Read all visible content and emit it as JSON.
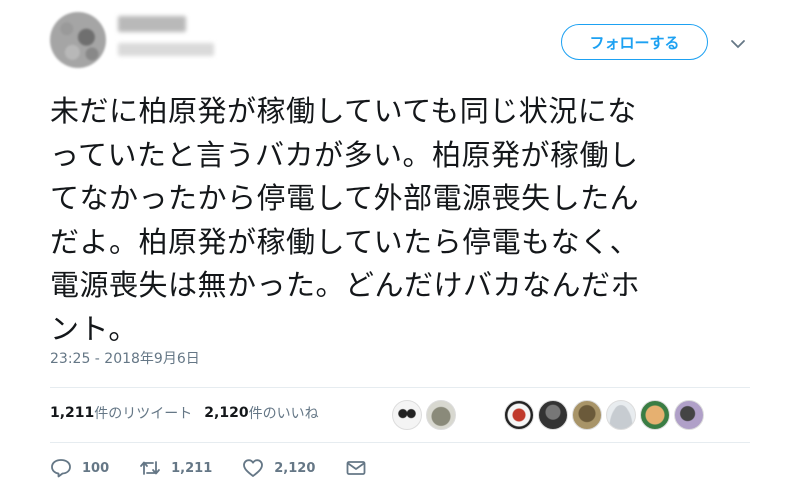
{
  "tweet": {
    "follow_label": "フォローする",
    "text_lines": [
      "未だに柏原発が稼働していても同じ状況にな",
      "っていたと言うバカが多い。柏原発が稼働し",
      "てなかったから停電して外部電源喪失したん",
      "だよ。柏原発が稼働していたら停電もなく、",
      "電源喪失は無かった。どんだけバカなんだホ",
      "ント。"
    ],
    "timestamp": "23:25 - 2018年9月6日"
  },
  "stats": {
    "retweets_count": "1,211",
    "retweets_label": "件のリツイート",
    "likes_count": "2,120",
    "likes_label": " 件のいいね"
  },
  "actions": {
    "reply_count": "100",
    "retweet_count": "1,211",
    "like_count": "2,120"
  },
  "colors": {
    "accent": "#1da1f2",
    "secondary_text": "#657786",
    "divider": "#e6ecf0"
  },
  "icons": [
    "caret-down-icon",
    "reply-icon",
    "retweet-icon",
    "heart-icon",
    "mail-icon"
  ]
}
